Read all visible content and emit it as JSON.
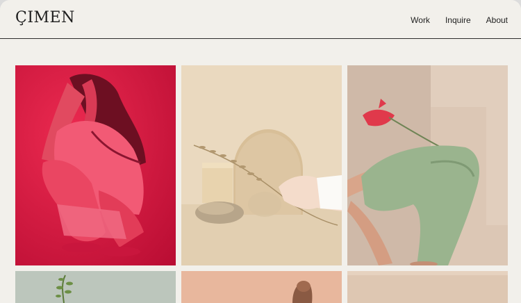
{
  "brand": {
    "logo": "ÇIMEN"
  },
  "nav": {
    "items": [
      "Work",
      "Inquire",
      "About"
    ]
  },
  "gallery": {
    "images": [
      {
        "name": "photo-woman-crouching-red",
        "color": "#d3153f"
      },
      {
        "name": "photo-dried-grass-still-life",
        "color": "#e4d3b7"
      },
      {
        "name": "photo-woman-with-anthurium",
        "color": "#cdb7a6"
      },
      {
        "name": "photo-plant-sprig-grey",
        "color": "#b9c3b8"
      },
      {
        "name": "photo-peach-portrait",
        "color": "#e6b69c"
      },
      {
        "name": "photo-beige-backdrop",
        "color": "#ddc6b0"
      }
    ]
  }
}
